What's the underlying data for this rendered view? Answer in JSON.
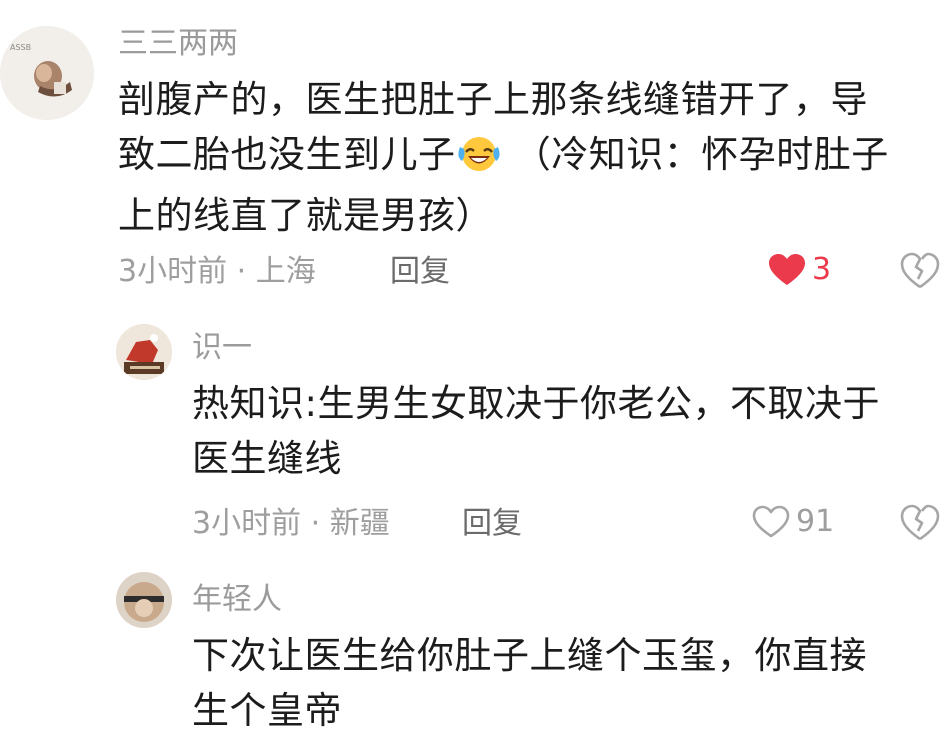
{
  "comments": [
    {
      "username": "三三两两",
      "lines": [
        "剖腹产的，医生把肚子上那条线缝错开了，导",
        "致二胎也没生到儿子",
        " （冷知识：怀孕时肚子",
        "上的线直了就是男孩）"
      ],
      "emoji": "laughing-tears-emoji",
      "time_location": "3小时前 · 上海",
      "reply_label": "回复",
      "likes": "3",
      "liked": true,
      "avatar_text": "ASSB"
    },
    {
      "username": "识一",
      "lines": [
        "热知识:生男生女取决于你老公，不取决于",
        "医生缝线"
      ],
      "time_location": "3小时前 · 新疆",
      "reply_label": "回复",
      "likes": "91",
      "liked": false
    },
    {
      "username": "年轻人",
      "lines": [
        "下次让医生给你肚子上缝个玉玺，你直接",
        "生个皇帝"
      ]
    }
  ],
  "colors": {
    "liked_heart": "#ea3a4b",
    "meta_text": "#9e9e9e",
    "username_text": "#9b9b9b"
  },
  "icons": [
    "heart-filled-icon",
    "heart-outline-icon",
    "broken-heart-icon",
    "laughing-tears-emoji"
  ]
}
